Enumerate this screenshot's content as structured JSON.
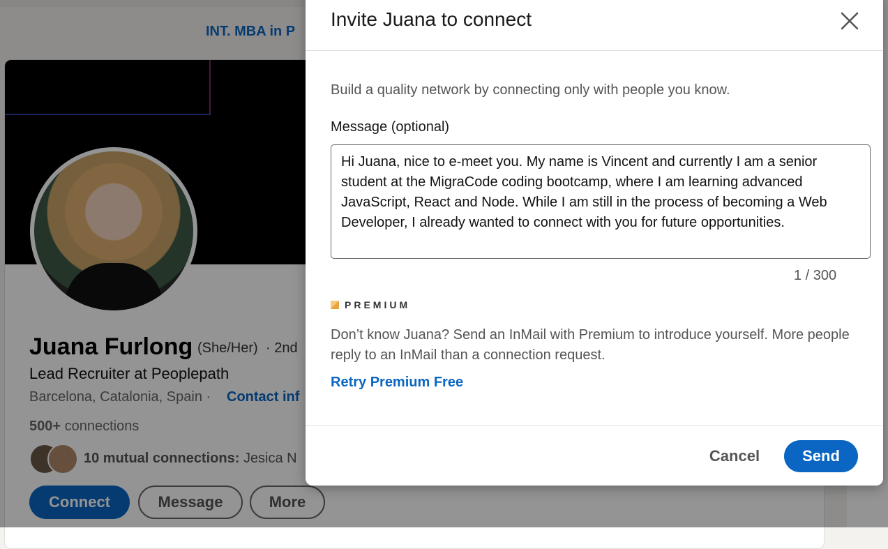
{
  "background": {
    "promo_link": "INT. MBA in P",
    "profile": {
      "name": "Juana Furlong",
      "pronouns": "(She/Her)",
      "degree": "· 2nd",
      "headline": "Lead Recruiter at Peoplepath",
      "location": "Barcelona, Catalonia, Spain ·",
      "contact_link": "Contact inf",
      "connections_count": "500+",
      "connections_suffix": "connections",
      "mutual_bold": "10 mutual connections:",
      "mutual_names": "Jesica N",
      "buttons": {
        "connect": "Connect",
        "message": "Message",
        "more": "More"
      }
    }
  },
  "modal": {
    "title": "Invite Juana to connect",
    "intro": "Build a quality network by connecting only with people you know.",
    "message_label": "Message (optional)",
    "message_value": "Hi Juana, nice to e-meet you. My name is Vincent and currently I am a senior student at the MigraCode coding bootcamp, where I am learning advanced JavaScript, React and Node. While I am still in the process of becoming a Web Developer, I already wanted to connect with you for future opportunities.",
    "counter": "1 / 300",
    "premium_label": "PREMIUM",
    "premium_desc": "Don’t know Juana? Send an InMail with Premium to introduce yourself. More people reply to an InMail than a connection request.",
    "retry_link": "Retry Premium Free",
    "cancel_label": "Cancel",
    "send_label": "Send"
  },
  "colors": {
    "accent": "#0a66c2",
    "overlay": "rgba(0,0,0,0.42)"
  },
  "icons": {
    "close": "close-icon",
    "premium": "premium-icon"
  }
}
